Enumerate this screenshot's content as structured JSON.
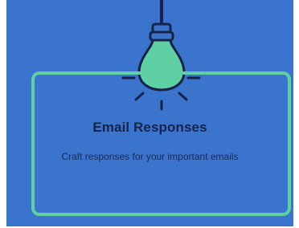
{
  "card": {
    "title": "Email Responses",
    "subtitle": "Craft responses for your important emails"
  },
  "icons": {
    "main": "lightbulb-icon"
  },
  "colors": {
    "background": "#3b74cc",
    "accent": "#5fd0a3",
    "text": "#17234a"
  }
}
